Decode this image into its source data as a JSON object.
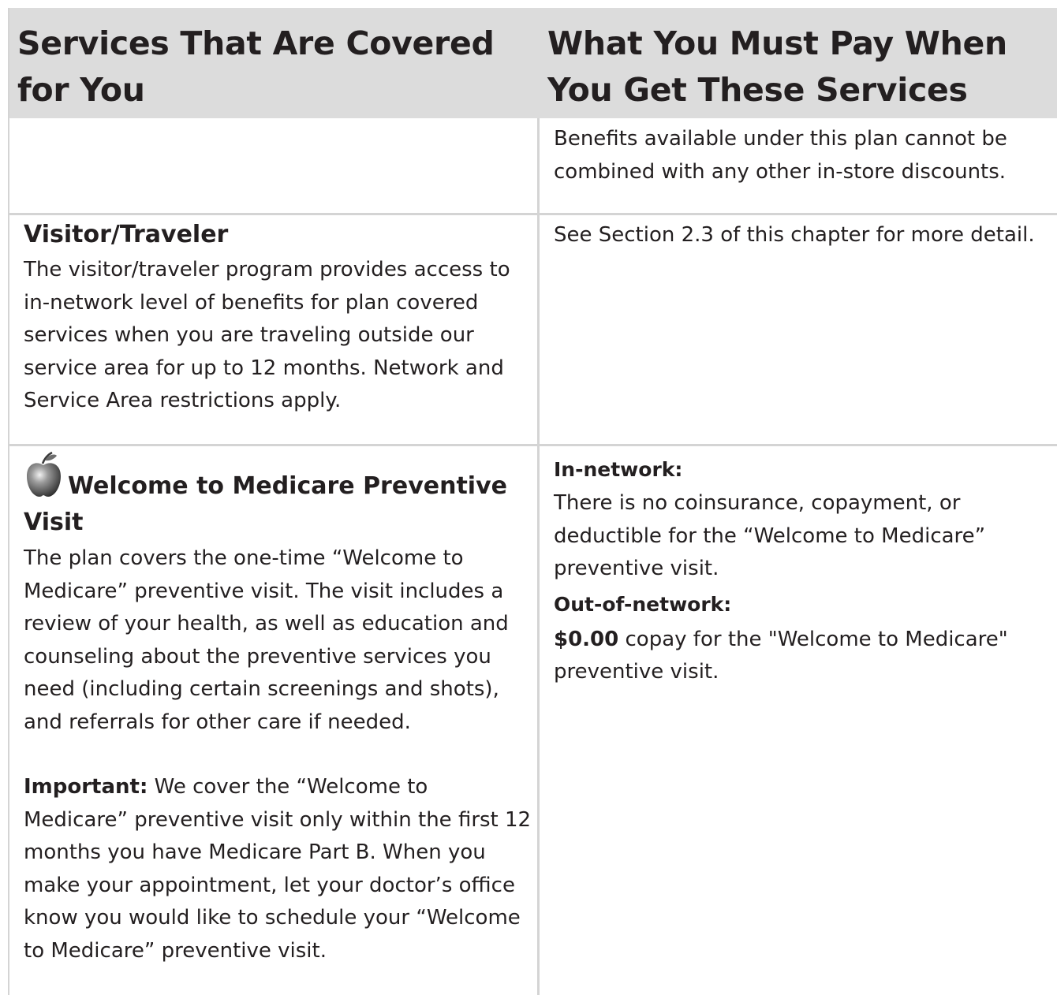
{
  "header": {
    "col1": "Services That Are Covered for You",
    "col2": "What You Must Pay When You Get These Services"
  },
  "row1": {
    "right_text": "Benefits available under this plan cannot be combined with any other in-store discounts."
  },
  "row2": {
    "title": "Visitor/Traveler",
    "description": "The visitor/traveler program provides access to in-network level of benefits for plan covered services when you are traveling outside our service area for up to 12 months. Network and Service Area restrictions apply.",
    "right_text": "See Section 2.3 of this chapter for more detail."
  },
  "row3": {
    "icon": "apple-icon",
    "title": "Welcome to Medicare Preventive Visit",
    "description": "The plan covers the one-time “Welcome to Medicare” preventive visit. The visit includes a review of your health, as well as education and counseling about the preventive services you need (including certain screenings and shots), and referrals for other care if needed.",
    "important_label": "Important:",
    "important_text": " We cover the “Welcome to Medicare” preventive visit only within the first 12 months you have Medicare Part B. When you make your appointment, let your doctor’s office know you would like to schedule your “Welcome to Medicare” preventive visit.",
    "in_network_label": "In-network:",
    "in_network_text": "There is no coinsurance, copayment, or deductible for the “Welcome to Medicare” preventive visit.",
    "out_network_label": "Out-of-network:",
    "out_network_amount": "$0.00",
    "out_network_text": " copay for the \"Welcome to Medicare\" preventive visit."
  }
}
